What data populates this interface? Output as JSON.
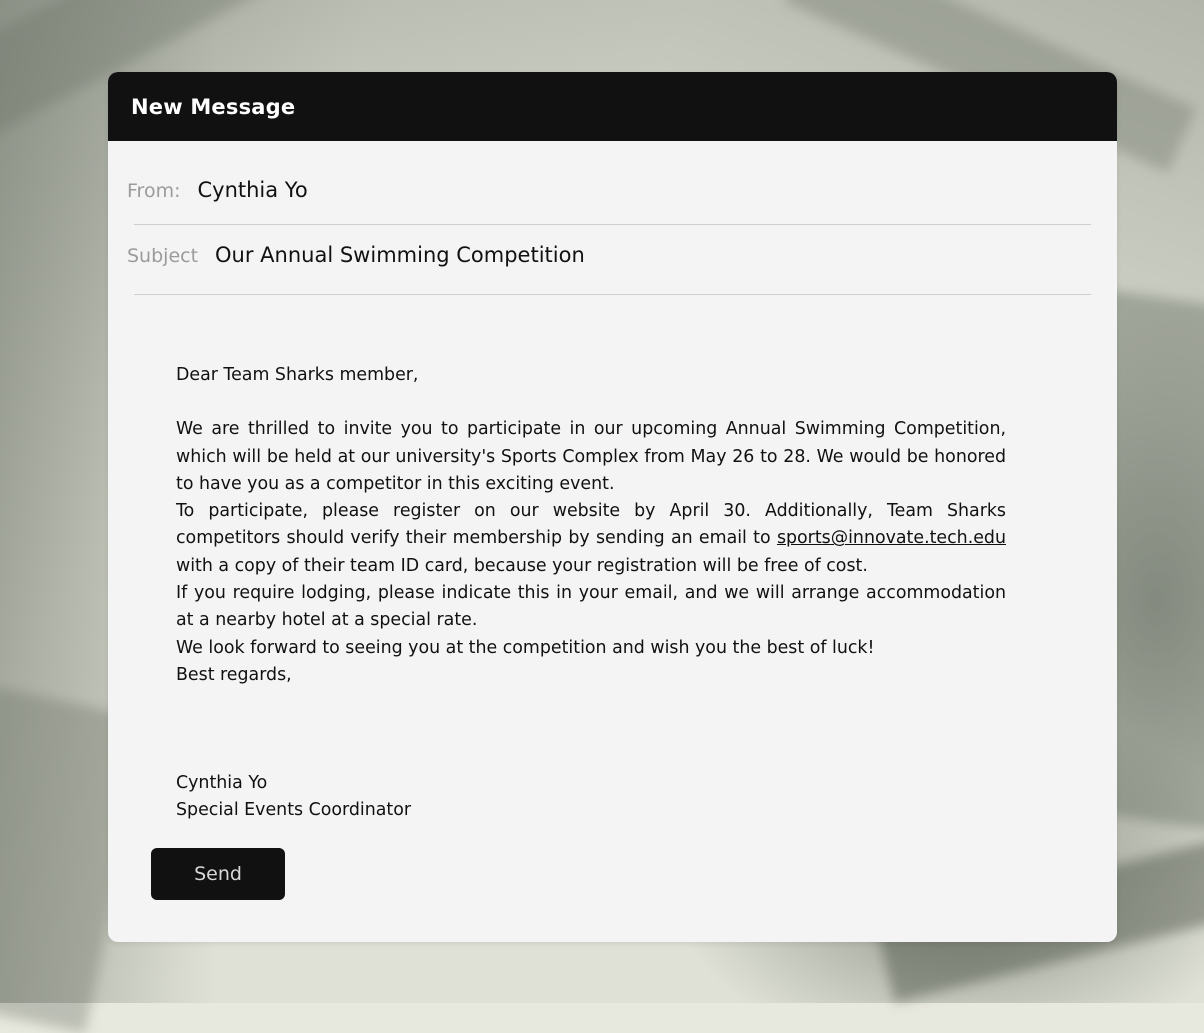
{
  "window": {
    "title": "New Message"
  },
  "fields": {
    "from_label": "From:",
    "from_value": "Cynthia Yo",
    "subject_label": "Subject",
    "subject_value": "Our Annual Swimming Competition"
  },
  "body": {
    "greeting": "Dear Team Sharks member,",
    "paragraph1": "We are thrilled to invite you to participate in our upcoming Annual Swimming Competition, which will be held at our university's Sports Complex from May 26 to 28. We would be honored to have you as a competitor in this exciting event.",
    "paragraph2_before": "To participate, please register on our website by April 30. Additionally, Team Sharks competitors should verify their membership by sending an email to ",
    "email_link": "sports@innovate.tech.edu",
    "paragraph2_after": " with a copy of their team ID card, because your registration will be free of cost.",
    "paragraph3": "If you require lodging, please indicate this in your email, and we will arrange accommodation at a nearby hotel at a special rate.",
    "paragraph4": "We look forward to seeing you at the competition and wish you the best of luck!",
    "closing": "Best regards,"
  },
  "signature": {
    "name": "Cynthia Yo",
    "role": "Special Events Coordinator"
  },
  "actions": {
    "send_label": "Send"
  },
  "colors": {
    "titlebar": "#111111",
    "window_bg": "#f4f4f4",
    "label_gray": "#9b9b9b",
    "button_bg": "#111111"
  }
}
